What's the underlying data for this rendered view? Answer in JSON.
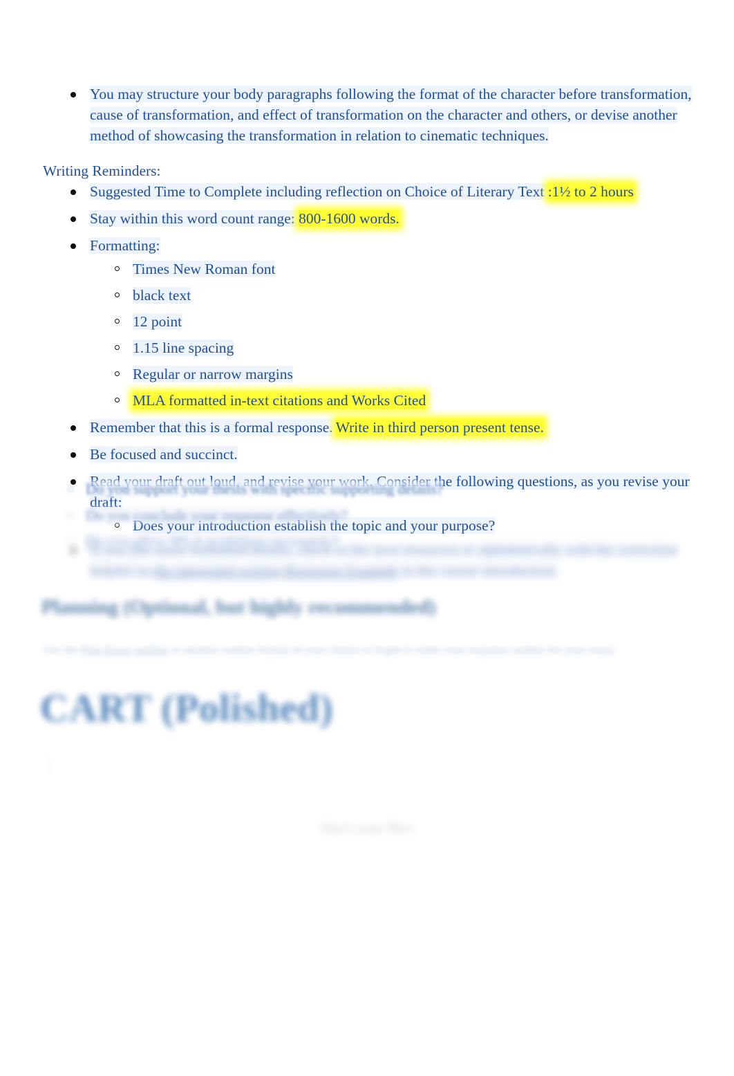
{
  "document": {
    "intro_bullet": "You may structure your body paragraphs following the format of the character before transformation, cause of transformation, and effect of transformation on the character and others, or devise another method of showcasing the transformation in relation to cinematic techniques.",
    "reminders_heading": "Writing Reminders:",
    "reminders": {
      "time_label": "Suggested Time to Complete including reflection on Choice of Literary Text ",
      "time_value": ":1½ to 2 hours",
      "word_count_label": "Stay within this word count range: ",
      "word_count_value": "800-1600 words.",
      "formatting_label": "Formatting:",
      "formatting_items": [
        "Times New Roman font",
        "black text",
        "12 point",
        "1.15 line spacing",
        "Regular or narrow margins",
        "MLA formatted in-text citations and Works Cited"
      ],
      "formal_response_label": "Remember that this is a formal response.",
      "formal_response_highlight": "Write in third person present tense.",
      "focused_label": "Be focused and succinct.",
      "revise_label": "Read your draft out loud, and revise your work. Consider the following questions, as you revise your draft:",
      "revise_questions": [
        "Does your introduction establish the topic and your purpose?",
        "Do you support your thesis with specific supporting details?",
        "Do you conclude your response effectively?",
        "Do you allow MLA guidelines accurately?"
      ],
      "resource_bullet_line1": "If you like more formatted details, check in the next resources or alphabetically with the correction helpful on",
      "resource_bullet_link": "the integrated writing Response Example",
      "resource_bullet_line2": " in the course introduction."
    },
    "planning_heading": "Planning (Optional, but highly recommended)",
    "planning_note_prefix": "Use the ",
    "planning_note_link": "Plan Essay outline",
    "planning_note_suffix": " or another outline format of your choice to begin to order your response outline for your essay.",
    "cart_heading": "CART (Polished)",
    "cart_caret": "│",
    "footer_note": "Start your flow"
  }
}
